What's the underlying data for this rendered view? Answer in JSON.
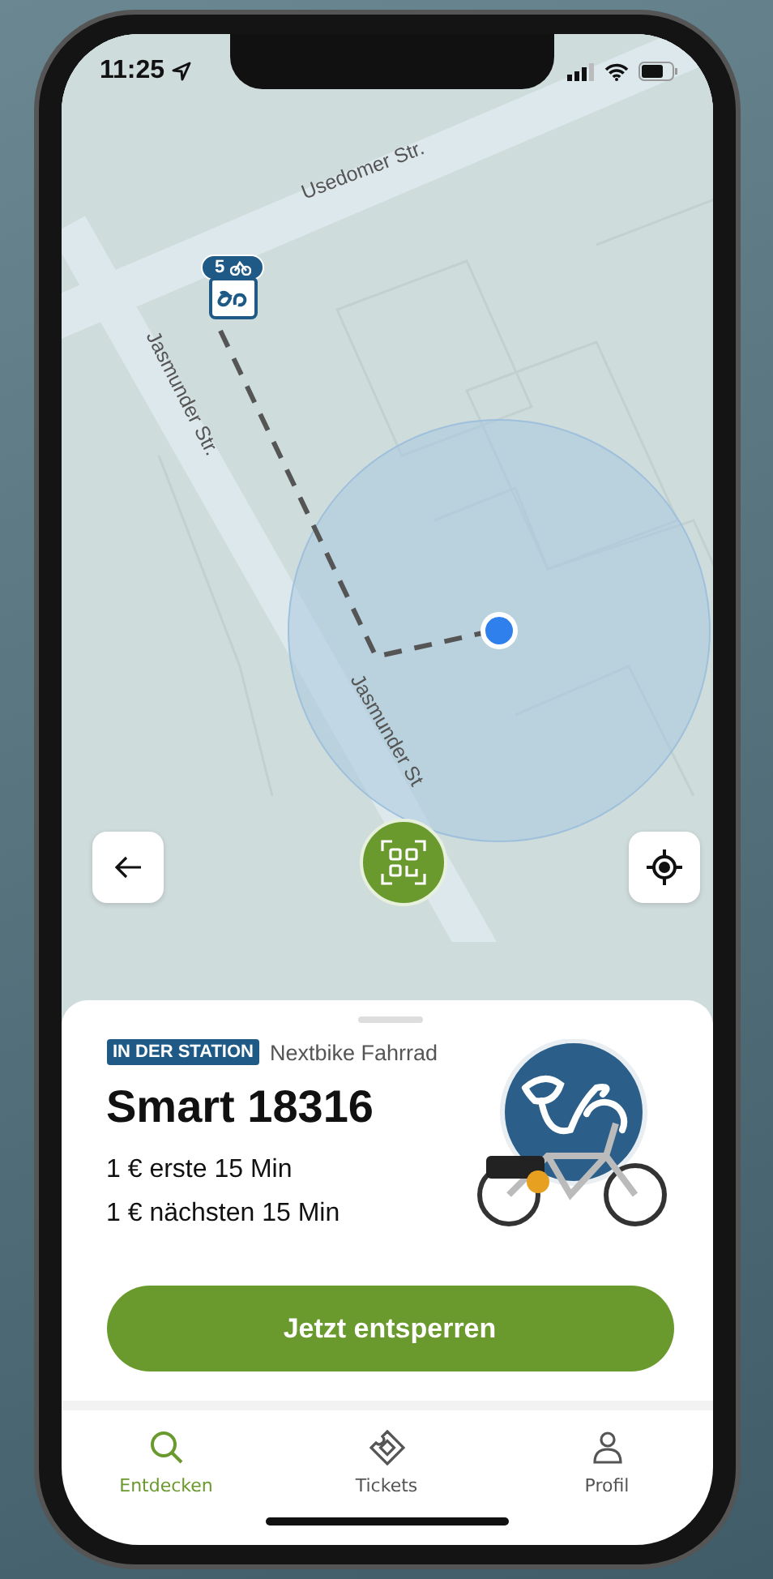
{
  "status_bar": {
    "time": "11:25"
  },
  "map": {
    "streets": [
      "Usedomer Str.",
      "Jasmunder Str.",
      "Jasmunder St"
    ],
    "station_marker": {
      "count": "5"
    }
  },
  "vehicle": {
    "badge": "IN DER STATION",
    "type": "Nextbike Fahrrad",
    "name": "Smart 18316",
    "prices": [
      "1 € erste 15 Min",
      "1 € nächsten 15 Min"
    ]
  },
  "unlock_button": {
    "label": "Jetzt entsperren"
  },
  "tab_bar": [
    {
      "label": "Entdecken",
      "selected": true
    },
    {
      "label": "Tickets",
      "selected": false
    },
    {
      "label": "Profil",
      "selected": false
    }
  ]
}
